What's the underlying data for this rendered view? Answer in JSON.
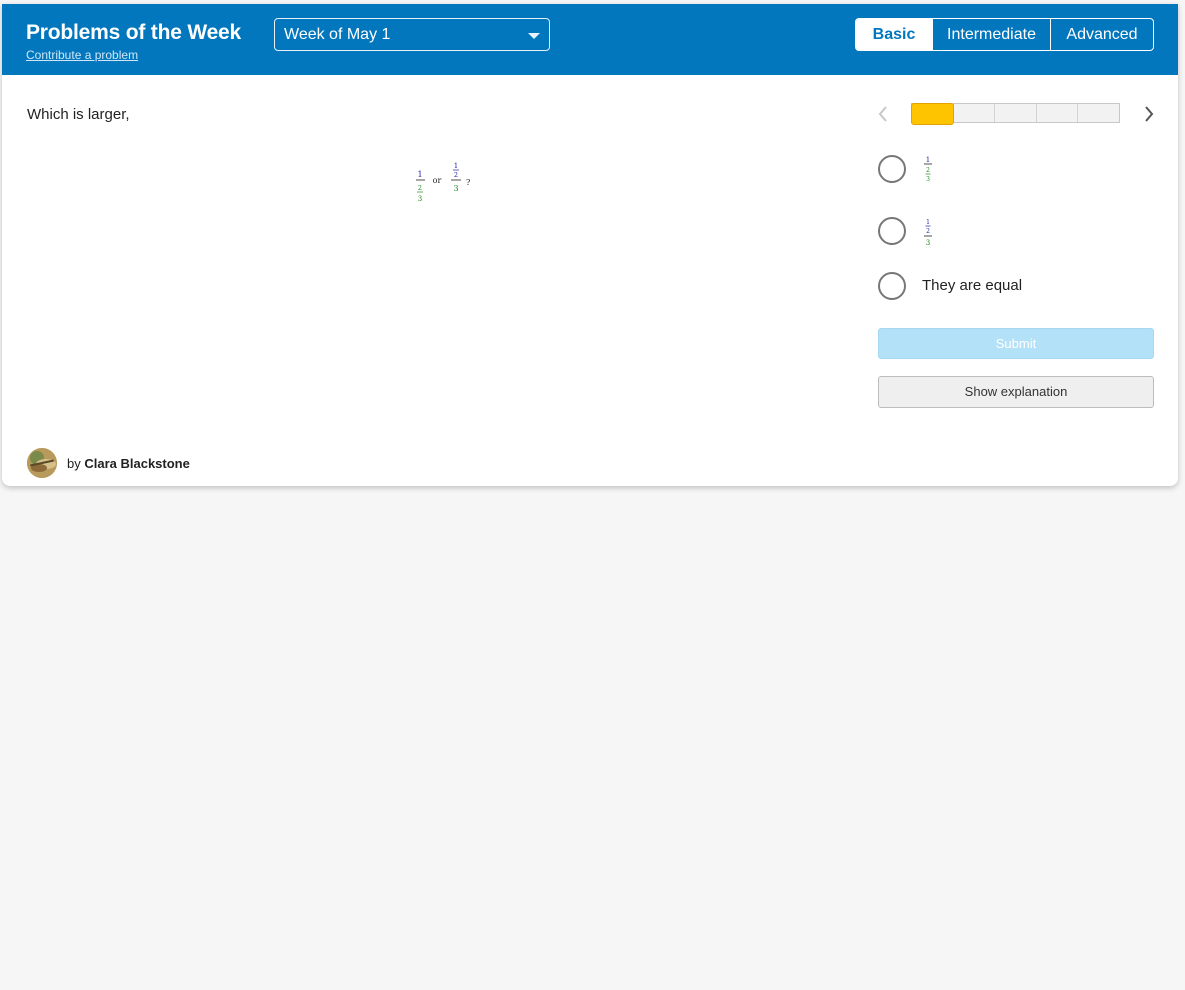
{
  "header": {
    "title": "Problems of the Week",
    "contribute_link": "Contribute a problem",
    "week_select": {
      "selected": "Week of May 1"
    },
    "levels": [
      {
        "label": "Basic",
        "active": true
      },
      {
        "label": "Intermediate",
        "active": false
      },
      {
        "label": "Advanced",
        "active": false
      }
    ]
  },
  "problem": {
    "question": "Which is larger,",
    "expression": {
      "left": {
        "num": "1",
        "den_num": "2",
        "den_den": "3"
      },
      "connector": "or",
      "right": {
        "num_num": "1",
        "num_den": "2",
        "den": "3"
      },
      "end": "?"
    }
  },
  "progress": {
    "segments": 5,
    "current": 1
  },
  "choices": [
    {
      "type": "fraction",
      "parts": [
        "1",
        "2",
        "3"
      ]
    },
    {
      "type": "fraction",
      "parts": [
        "1",
        "2",
        "3"
      ]
    },
    {
      "type": "text",
      "label": "They are equal"
    }
  ],
  "actions": {
    "submit": "Submit",
    "explanation": "Show explanation"
  },
  "author": {
    "prefix": "by",
    "name": "Clara Blackstone"
  },
  "colors": {
    "brand": "#0277bd",
    "progress_fill": "#ffc400",
    "submit_disabled": "#b3e1f7",
    "math_blue": "#1a1aa6",
    "math_green": "#1e8c1e"
  }
}
